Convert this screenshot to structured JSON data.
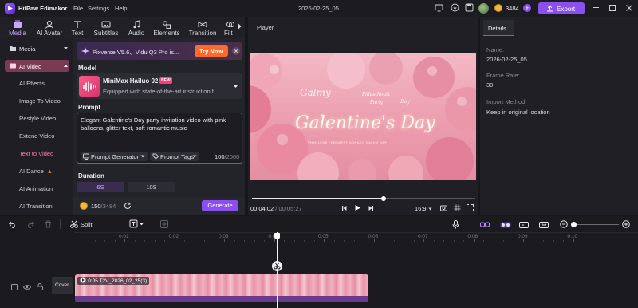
{
  "app": {
    "name": "HitPaw Edimakor",
    "menu": [
      "File",
      "Settings",
      "Help"
    ],
    "project_title": "2026-02-25_05",
    "credits": "3484",
    "export_label": "Export"
  },
  "toolbar": {
    "tabs": [
      {
        "label": "Media",
        "icon": "media-icon"
      },
      {
        "label": "AI Avatar",
        "icon": "ai-avatar-icon"
      },
      {
        "label": "Text",
        "icon": "text-icon"
      },
      {
        "label": "Subtitles",
        "icon": "subtitles-icon"
      },
      {
        "label": "Audio",
        "icon": "audio-icon"
      },
      {
        "label": "Elements",
        "icon": "elements-icon"
      },
      {
        "label": "Transition",
        "icon": "transition-icon"
      },
      {
        "label": "Filt",
        "icon": "filter-icon"
      }
    ],
    "active": "Media"
  },
  "sidebar": {
    "media_label": "Media",
    "ai_video_label": "AI Video",
    "items": [
      "AI Effects",
      "Image To Video",
      "Restyle Video",
      "Extend Video",
      "Text to Video",
      "AI Dance",
      "AI Animation",
      "AI Transition"
    ],
    "selected": "Text to Video"
  },
  "banner": {
    "text": "Pixverse V5.6、Vidu Q3 Pro is...",
    "button": "Try Now"
  },
  "model": {
    "section_label": "Model",
    "name": "MiniMax Hailuo 02",
    "badge": "NEW",
    "description": "Equipped with state-of-the-art instruction f..."
  },
  "prompt": {
    "section_label": "Prompt",
    "value": "Elegant Galentine's Day party invitation video with pink balloons, glitter text, soft romantic music",
    "generator_label": "Prompt Generator",
    "tags_label": "Prompt Tags",
    "count": "100",
    "max": "/2000"
  },
  "duration": {
    "section_label": "Duration",
    "options": [
      "6S",
      "10S"
    ],
    "selected": "6S"
  },
  "generate": {
    "credits_used": "150",
    "credits_total": "/3484",
    "button": "Generate"
  },
  "player": {
    "title": "Player",
    "video_text": {
      "line1": "Galmy",
      "line2": "Pillesthoutt",
      "line3": "Party",
      "line4": "Day",
      "main": "Galentine's Day",
      "sub": "VHKHLESS FEBSGFRT SONAEC GALEN DAY"
    },
    "current_time": "00:04:02",
    "total_time": "/ 00:05:27",
    "aspect": "16:9",
    "progress": 0.59
  },
  "details": {
    "tab": "Details",
    "fields": [
      {
        "label": "Name:",
        "value": "2026-02-25_05"
      },
      {
        "label": "Frame Rate:",
        "value": "30"
      },
      {
        "label": "Import Method:",
        "value": "Keep in original location"
      }
    ]
  },
  "timeline": {
    "split_label": "Split",
    "ruler": [
      "0:01",
      "0:02",
      "0:03",
      "0:04",
      "0:05",
      "0:06",
      "0:07",
      "0:08",
      "0:09",
      "0:10"
    ],
    "cover_label": "Cover",
    "clip_label": "0:05 T2V_2026_02_25(3)"
  },
  "colors": {
    "accent": "#8b4ff0",
    "brand_pink": "#e2528f",
    "banner_button": "#ff6a2c"
  }
}
